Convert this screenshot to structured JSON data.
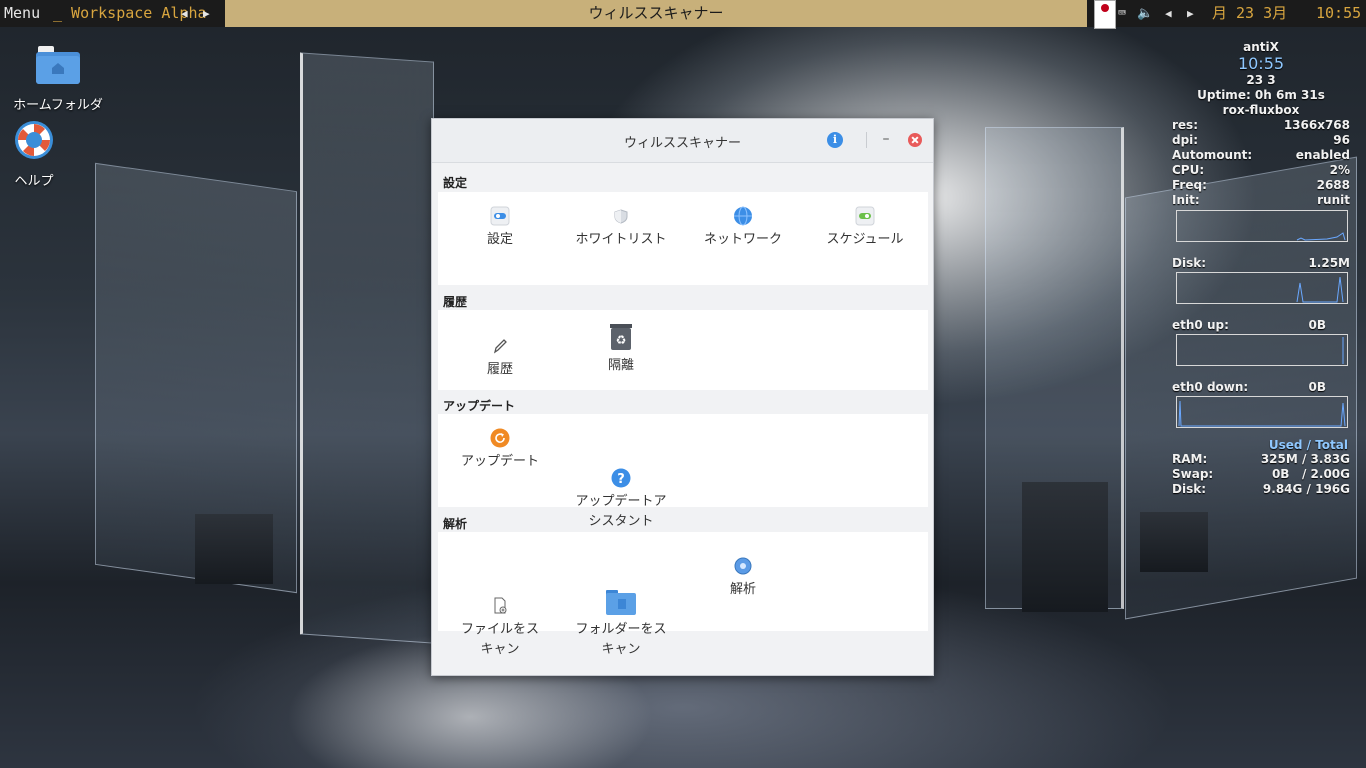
{
  "taskbar": {
    "menu": "Menu",
    "workspace": "_ Workspace Alpha",
    "prev_arrow": "◀",
    "next_arrow": "▶",
    "window_title": "ウィルススキャナー",
    "left_arrow": "◀",
    "right_arrow": "▶",
    "date": "月 23  3月",
    "clock": "10:55"
  },
  "desktop_icons": [
    {
      "label": "ホームフォルダ",
      "icon": "home-folder-icon"
    },
    {
      "label": "ヘルプ",
      "icon": "lifebuoy-icon"
    }
  ],
  "conky": {
    "distro": "antiX",
    "time": "10:55",
    "date": "23  3",
    "uptime": "Uptime: 0h 6m 31s",
    "session": "rox-fluxbox",
    "stats": [
      {
        "k": "res:",
        "v": "1366x768"
      },
      {
        "k": "dpi:",
        "v": "96"
      },
      {
        "k": "Automount:",
        "v": "enabled"
      },
      {
        "k": "CPU:",
        "v": "2%"
      },
      {
        "k": "Freq:",
        "v": "2688"
      },
      {
        "k": "Init:",
        "v": "runit"
      }
    ],
    "disk_io": {
      "k": "Disk:",
      "v": "1.25M"
    },
    "eth_up": {
      "k": "eth0 up:",
      "v": "0B"
    },
    "eth_down": {
      "k": "eth0 down:",
      "v": "0B"
    },
    "used_total": "Used / Total",
    "usage": [
      {
        "k": "RAM:",
        "v": "325M  / 3.83G"
      },
      {
        "k": "Swap:",
        "v": "0B   / 2.00G"
      },
      {
        "k": "Disk:",
        "v": "9.84G / 196G"
      }
    ]
  },
  "window": {
    "title": "ウィルススキャナー",
    "info_symbol": "i",
    "minimize_symbol": "–",
    "sections": [
      {
        "title": "設定",
        "items": [
          "設定",
          "ホワイトリスト",
          "ネットワーク",
          "スケジュール"
        ]
      },
      {
        "title": "履歴",
        "items": [
          "履歴",
          "隔離"
        ]
      },
      {
        "title": "アップデート",
        "items": [
          "アップデート",
          "アップデートア\nシスタント"
        ]
      },
      {
        "title": "解析",
        "items": [
          "ファイルをス\nキャン",
          "フォルダーをス\nキャン",
          "解析"
        ]
      }
    ]
  },
  "colors": {
    "accent": "#3c8ee6",
    "taskbar_title_bg": "#c8b07a",
    "clock": "#d8a53f",
    "close": "#e85a5a"
  }
}
